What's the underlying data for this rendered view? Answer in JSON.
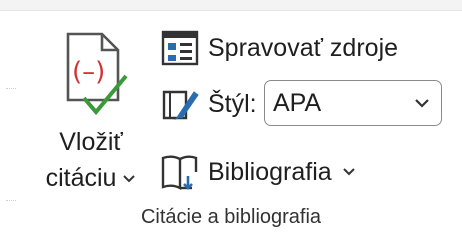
{
  "insert_citation": {
    "label_line1": "Vložiť",
    "label_line2": "citáciu",
    "icon": "citation-icon"
  },
  "manage_sources": {
    "label": "Spravovať zdroje",
    "icon": "manage-sources-icon"
  },
  "style": {
    "label": "Štýl:",
    "value": "APA",
    "icon": "style-brush-icon"
  },
  "bibliography": {
    "label": "Bibliografia",
    "icon": "bibliography-icon"
  },
  "group": {
    "label": "Citácie a bibliografia"
  },
  "colors": {
    "accent_blue": "#2b6cb0",
    "citation_red": "#d13438",
    "check_green": "#3a9a3a"
  }
}
